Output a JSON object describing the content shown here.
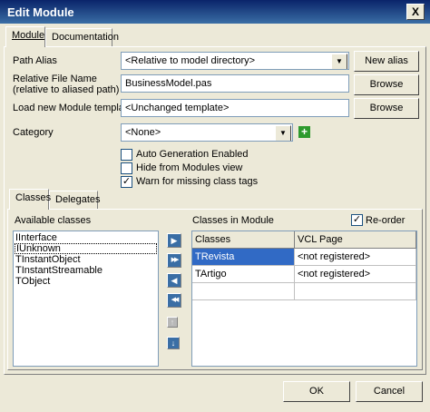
{
  "window": {
    "title": "Edit Module",
    "close_glyph": "X"
  },
  "tabs": [
    {
      "label": "Module"
    },
    {
      "label": "Documentation"
    }
  ],
  "form": {
    "path_alias_label": "Path Alias",
    "path_alias_value": "<Relative to model directory>",
    "new_alias_label": "New alias",
    "relative_file_label_line1": "Relative File Name",
    "relative_file_label_line2": "(relative to aliased path)",
    "relative_file_value": "BusinessModel.pas",
    "browse_label": "Browse",
    "template_label": "Load new Module template",
    "template_value": "<Unchanged template>",
    "category_label": "Category",
    "category_value": "<None>",
    "add_glyph": "+",
    "checkboxes": [
      {
        "label": "Auto Generation Enabled",
        "checked": false
      },
      {
        "label": "Hide from Modules view",
        "checked": false
      },
      {
        "label": "Warn for missing class tags",
        "checked": true
      }
    ]
  },
  "subtabs": [
    {
      "label": "Classes"
    },
    {
      "label": "Delegates"
    }
  ],
  "classes": {
    "available_label": "Available classes",
    "available": [
      "IInterface",
      "IUnknown",
      "TInstantObject",
      "TInstantStreamable",
      "TObject"
    ],
    "selected_index": 1,
    "module_label": "Classes in Module",
    "reorder_label": "Re-order",
    "reorder_checked": true,
    "columns": [
      "Classes",
      "VCL Page"
    ],
    "rows": [
      [
        "TRevista",
        "<not registered>"
      ],
      [
        "TArtigo",
        "<not registered>"
      ]
    ],
    "arrows": [
      {
        "icon": "move-right-icon",
        "glyph": "▶"
      },
      {
        "icon": "move-all-right-icon",
        "glyph": "▶▶"
      },
      {
        "icon": "move-left-icon",
        "glyph": "◀"
      },
      {
        "icon": "move-all-left-icon",
        "glyph": "◀◀"
      },
      {
        "icon": "move-up-icon",
        "glyph": "↑"
      },
      {
        "icon": "move-down-icon",
        "glyph": "↓"
      }
    ]
  },
  "footer": {
    "ok_label": "OK",
    "cancel_label": "Cancel"
  }
}
